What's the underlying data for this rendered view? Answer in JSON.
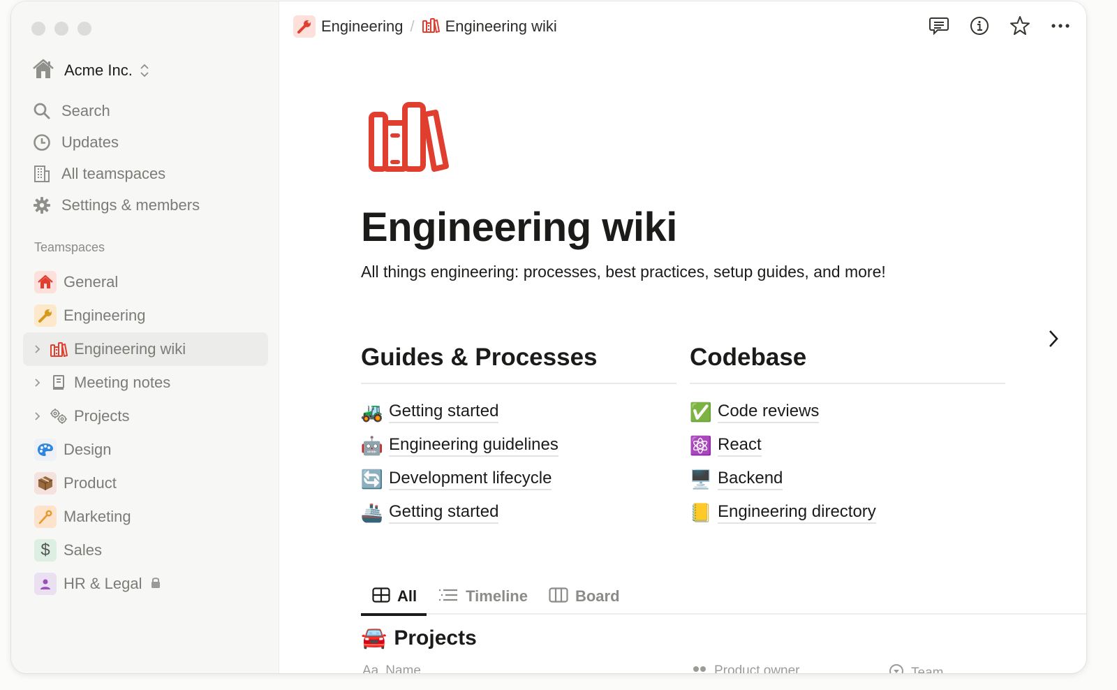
{
  "sidebar": {
    "workspace": {
      "name": "Acme Inc.",
      "icon": "house-icon"
    },
    "nav": [
      {
        "label": "Search",
        "icon": "search-icon"
      },
      {
        "label": "Updates",
        "icon": "clock-icon"
      },
      {
        "label": "All teamspaces",
        "icon": "building-icon"
      },
      {
        "label": "Settings & members",
        "icon": "gear-icon"
      }
    ],
    "section_label": "Teamspaces",
    "teamspaces": [
      {
        "label": "General",
        "icon": "🏠",
        "bg": "#fde0dc"
      },
      {
        "label": "Engineering",
        "icon": "🔧",
        "bg": "#fde8cc"
      },
      {
        "label": "Engineering wiki",
        "icon": "books-icon",
        "child": true,
        "active": true
      },
      {
        "label": "Meeting notes",
        "icon": "notebook-icon",
        "child": true
      },
      {
        "label": "Projects",
        "icon": "gears-icon",
        "child": true
      },
      {
        "label": "Design",
        "icon": "🎨",
        "bg": "#eef1f5"
      },
      {
        "label": "Product",
        "icon": "📦",
        "bg": "#f5e2de"
      },
      {
        "label": "Marketing",
        "icon": "🎤",
        "bg": "#fde3cc"
      },
      {
        "label": "Sales",
        "icon": "$",
        "bg": "#ddefe2"
      },
      {
        "label": "HR & Legal",
        "icon": "👤",
        "bg": "#ebe0f2",
        "locked": true
      }
    ]
  },
  "topbar": {
    "breadcrumb": [
      {
        "label": "Engineering",
        "icon": "wrench-icon"
      },
      {
        "label": "Engineering wiki",
        "icon": "books-icon"
      }
    ],
    "separator": "/",
    "actions": [
      "comments-icon",
      "info-icon",
      "star-icon",
      "more-icon"
    ]
  },
  "page": {
    "title": "Engineering wiki",
    "description": "All things engineering: processes, best practices, setup guides, and more!",
    "accent": "#e03e2f",
    "columns": [
      {
        "heading": "Guides & Processes",
        "links": [
          {
            "emoji": "🚜",
            "label": "Getting started"
          },
          {
            "emoji": "🤖",
            "label": "Engineering guidelines"
          },
          {
            "emoji": "🔄",
            "label": "Development lifecycle"
          },
          {
            "emoji": "🚢",
            "label": "Getting started"
          }
        ]
      },
      {
        "heading": "Codebase",
        "links": [
          {
            "emoji": "✅",
            "label": "Code reviews"
          },
          {
            "emoji": "⚛️",
            "label": "React"
          },
          {
            "emoji": "🖥️",
            "label": "Backend"
          },
          {
            "emoji": "📒",
            "label": "Engineering directory"
          }
        ]
      }
    ],
    "tabs": [
      {
        "label": "All",
        "icon": "table-icon",
        "active": true
      },
      {
        "label": "Timeline",
        "icon": "timeline-icon"
      },
      {
        "label": "Board",
        "icon": "board-icon"
      }
    ],
    "database": {
      "emoji": "🚘",
      "title": "Projects",
      "columns": [
        {
          "label": "Name",
          "prefix": "Aa"
        },
        {
          "label": "Product owner",
          "icon": "people-icon"
        },
        {
          "label": "Team",
          "icon": "select-icon"
        }
      ]
    }
  }
}
